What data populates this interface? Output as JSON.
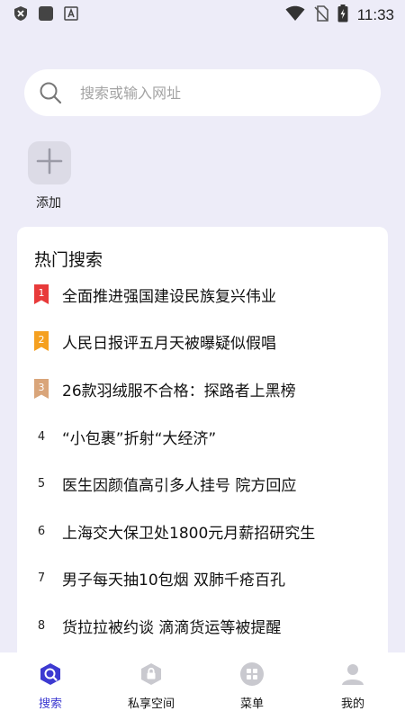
{
  "status_bar": {
    "time": "11:33"
  },
  "search": {
    "placeholder": "搜索或输入网址"
  },
  "shortcut": {
    "add_label": "添加"
  },
  "hot": {
    "title": "热门搜索",
    "items": [
      {
        "rank": "1",
        "text": "全面推进强国建设民族复兴伟业"
      },
      {
        "rank": "2",
        "text": "人民日报评五月天被曝疑似假唱"
      },
      {
        "rank": "3",
        "text": "26款羽绒服不合格：探路者上黑榜"
      },
      {
        "rank": "4",
        "text": "“小包裹”折射“大经济”"
      },
      {
        "rank": "5",
        "text": "医生因颜值高引多人挂号 院方回应"
      },
      {
        "rank": "6",
        "text": "上海交大保卫处1800元月薪招研究生"
      },
      {
        "rank": "7",
        "text": "男子每天抽10包烟 双肺千疮百孔"
      },
      {
        "rank": "8",
        "text": "货拉拉被约谈 滴滴货运等被提醒"
      }
    ]
  },
  "nav": {
    "search": "搜索",
    "private": "私享空间",
    "menu": "菜单",
    "mine": "我的"
  },
  "colors": {
    "accent": "#3d3ad1",
    "rank1": "#e83a3a",
    "rank2": "#f5a020",
    "rank3": "#d9a57a"
  }
}
